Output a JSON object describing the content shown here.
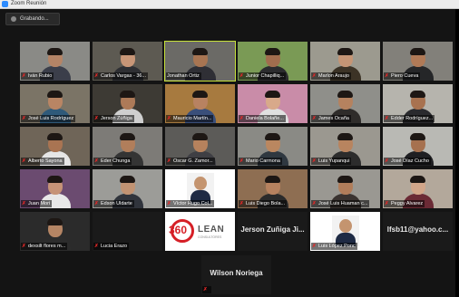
{
  "window": {
    "title": "Zoom Reunión"
  },
  "recording": {
    "label": "Grabando..."
  },
  "participants": [
    {
      "name": "Iván Rubio",
      "muted": true,
      "bg": "#8a8a86",
      "skin": "#b58466",
      "shirt": "#3b3e4a"
    },
    {
      "name": "Carlos Vargas - 36...",
      "muted": true,
      "bg": "#5d5a52",
      "skin": "#c89677",
      "shirt": "#2e2f33"
    },
    {
      "name": "Jonathan Ortiz",
      "muted": false,
      "speaking": true,
      "bg": "#6b6a66",
      "skin": "#a87552",
      "shirt": "#2f2f35"
    },
    {
      "name": "Junior Chapilliq...",
      "muted": true,
      "bg": "#7a9a55",
      "skin": "#a16d4e",
      "shirt": "#2b2b2e"
    },
    {
      "name": "Marlon Araujo",
      "muted": true,
      "bg": "#9c9a8f",
      "skin": "#c59575",
      "shirt": "#3c3326"
    },
    {
      "name": "Piero Cueva",
      "muted": true,
      "bg": "#82807a",
      "skin": "#b07a57",
      "shirt": "#252628"
    },
    {
      "name": "José Luis Rodríguez",
      "muted": true,
      "bg": "#7b7466",
      "skin": "#b98564",
      "shirt": "#2f5a7a"
    },
    {
      "name": "Jerson Zúñiga",
      "muted": true,
      "bg": "#3d3a34",
      "skin": "#ad7a58",
      "shirt": "#cfcfcf"
    },
    {
      "name": "Mauricio Martín...",
      "muted": true,
      "bg": "#a77a3f",
      "skin": "#b88261",
      "shirt": "#3a4f7a"
    },
    {
      "name": "Daniela Bolañe...",
      "muted": true,
      "bg": "#c98ca8",
      "skin": "#d8a98a",
      "shirt": "#e0e0e0"
    },
    {
      "name": "James Ocaña",
      "muted": true,
      "bg": "#8f8f8a",
      "skin": "#b5825f",
      "shirt": "#2f2c2a"
    },
    {
      "name": "Edder Rodríguez...",
      "muted": true,
      "bg": "#b6b4ad",
      "skin": "#a87250",
      "shirt": "#2a2a2e"
    },
    {
      "name": "Alberto Sayona",
      "muted": true,
      "bg": "#6f6558",
      "skin": "#a97452",
      "shirt": "#e6e6e6"
    },
    {
      "name": "Eder Chunga",
      "muted": true,
      "bg": "#7d7b77",
      "skin": "#b17e5b",
      "shirt": "#343434"
    },
    {
      "name": "Oscar G. Zamor...",
      "muted": true,
      "bg": "#5c5b58",
      "skin": "#b6825d",
      "shirt": "#3f3f44"
    },
    {
      "name": "Mario Carmona",
      "muted": true,
      "bg": "#8a8a85",
      "skin": "#ba8760",
      "shirt": "#2f3840"
    },
    {
      "name": "Luis Yupanqui",
      "muted": true,
      "bg": "#9b9890",
      "skin": "#b8845f",
      "shirt": "#2c2c2c"
    },
    {
      "name": "José Díaz Cucho",
      "muted": true,
      "bg": "#b9b9b4",
      "skin": "#a6714f",
      "shirt": "#1f1f22"
    },
    {
      "name": "Juan Mori",
      "muted": true,
      "bg": "#6b4b70",
      "skin": "#c69377",
      "shirt": "#e8e8e8"
    },
    {
      "name": "Edson Uldarte",
      "muted": true,
      "bg": "#9c9c98",
      "skin": "#c19373",
      "shirt": "#30343c"
    },
    {
      "name": "Víctor Hugo Col...",
      "muted": true,
      "bg": "#ffffff",
      "skin": "#c4946f",
      "shirt": "#1e2a44",
      "card": true
    },
    {
      "name": "Luis Diego Bola...",
      "muted": true,
      "bg": "#8e6e52",
      "skin": "#b7825f",
      "shirt": "#2b2b2b"
    },
    {
      "name": "José Luis Huaman c...",
      "muted": true,
      "bg": "#9a9892",
      "skin": "#b17d5a",
      "shirt": "#3a3330"
    },
    {
      "name": "Peggy Alvarez",
      "muted": true,
      "bg": "#b3a89b",
      "skin": "#d2a68a",
      "shirt": "#6b2a35"
    },
    {
      "name": "dexsilt flores m...",
      "muted": true,
      "bg": "#2b2b2b",
      "skin": "#b58564",
      "shirt": "#2c2c2c"
    },
    {
      "name": "Lucia Erazo",
      "muted": true,
      "textonly": true,
      "bigname": ""
    },
    {
      "name": "",
      "muted": false,
      "logo": true
    },
    {
      "name": "",
      "muted": false,
      "textonly": true,
      "bigname": "Jerson Zuñiga Ji..."
    },
    {
      "name": "Luis López Ponc",
      "muted": true,
      "bg": "#ffffff",
      "skin": "#c4946f",
      "shirt": "#1e2a44",
      "card": true
    },
    {
      "name": "",
      "muted": false,
      "textonly": true,
      "bigname": "lfsb11@yahoo.c..."
    },
    {
      "name": "Wilson Noriega",
      "muted": true,
      "textonly": true,
      "bigname": "Wilson Noriega",
      "hideLabel": true
    }
  ],
  "logo": {
    "number": "360",
    "word": "LEAN",
    "sub": "CONSULTORES"
  }
}
